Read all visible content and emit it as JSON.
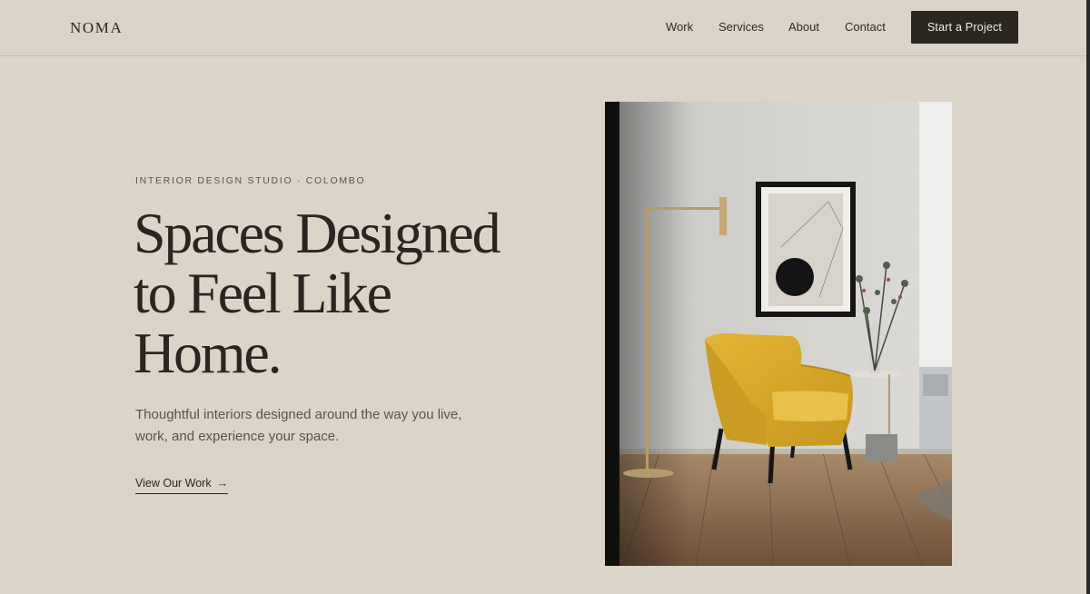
{
  "nav": {
    "logo": "NOMA",
    "links": [
      "Work",
      "Services",
      "About",
      "Contact"
    ],
    "cta": "Start a Project"
  },
  "hero": {
    "eyebrow": "INTERIOR DESIGN STUDIO · COLOMBO",
    "headline_lines": [
      "Spaces Designed",
      "to Feel Like",
      "Home."
    ],
    "subtext": "Thoughtful interiors designed around the way you live, work, and experience your space.",
    "link_label": "View Our Work",
    "link_icon": "arrow-right-icon",
    "image_subject": "interior-photo"
  },
  "colors": {
    "background": "#dbd4c8",
    "text": "#2a2520",
    "muted": "#5a534b",
    "button": "#2b2620",
    "chair": "#d9ab2c"
  }
}
